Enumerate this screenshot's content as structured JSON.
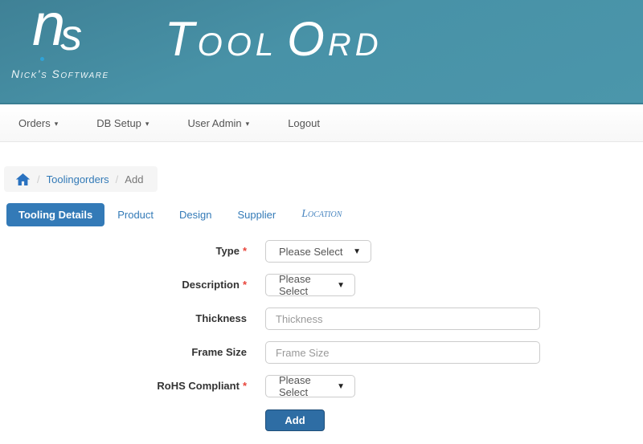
{
  "header": {
    "logo_monogram_parts": [
      "n",
      "s"
    ],
    "logo_subtitle": "Nick's Software",
    "title": "ToolOrd",
    "title_parts": [
      "T",
      "ool",
      "O",
      "rd"
    ]
  },
  "icons": {
    "caret_down": "▾",
    "select_arrow": "▼",
    "home_icon": "house"
  },
  "nav": {
    "items": [
      {
        "label": "Orders",
        "has_caret": true
      },
      {
        "label": "DB Setup",
        "has_caret": true
      },
      {
        "label": "User Admin",
        "has_caret": true
      },
      {
        "label": "Logout",
        "has_caret": false
      }
    ]
  },
  "breadcrumb": {
    "separator": "/",
    "items": [
      "Toolingorders",
      "Add"
    ]
  },
  "tabs": {
    "items": [
      {
        "label": "Tooling Details",
        "active": true
      },
      {
        "label": "Product",
        "active": false
      },
      {
        "label": "Design",
        "active": false
      },
      {
        "label": "Supplier",
        "active": false
      },
      {
        "label": "Location",
        "active": false
      }
    ]
  },
  "form": {
    "required_marker": "*",
    "rows": [
      {
        "label": "Type",
        "required": true,
        "control": "select",
        "value": "Please Select"
      },
      {
        "label": "Description",
        "required": true,
        "control": "select",
        "value": "Please Select"
      },
      {
        "label": "Thickness",
        "required": false,
        "control": "input",
        "placeholder": "Thickness"
      },
      {
        "label": "Frame Size",
        "required": false,
        "control": "input",
        "placeholder": "Frame Size"
      },
      {
        "label": "RoHS Compliant",
        "required": true,
        "control": "select",
        "value": "Please Select"
      }
    ],
    "submit_label": "Add"
  },
  "colors": {
    "header_teal": "#4892a7",
    "accent_blue": "#337ab7",
    "button_blue": "#2e6da4",
    "button_border": "#1f4e79",
    "required_red": "#e8443a",
    "nav_text": "#555555",
    "breadcrumb_bg": "#f5f5f5"
  }
}
